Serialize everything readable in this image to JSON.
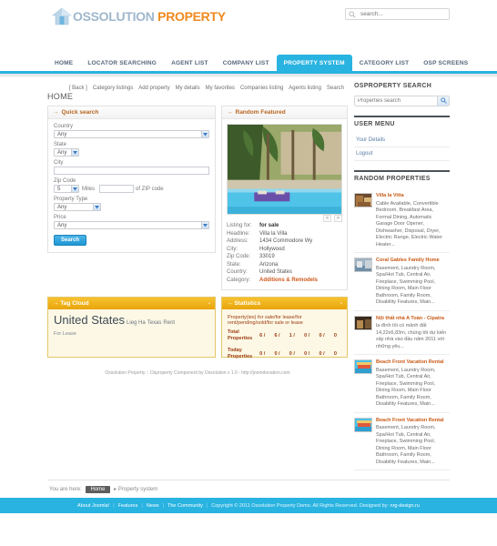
{
  "header": {
    "logo_os": "OSSOLUTION",
    "logo_property": "PROPERTY",
    "search_placeholder": "search...",
    "search_value": ""
  },
  "mainnav": {
    "items": [
      {
        "label": "HOME",
        "active": false
      },
      {
        "label": "LOCATOR SEARCHING",
        "active": false
      },
      {
        "label": "AGENT LIST",
        "active": false
      },
      {
        "label": "COMPANY LIST",
        "active": false
      },
      {
        "label": "PROPERTY SYSTEM",
        "active": true
      },
      {
        "label": "CATEGORY LIST",
        "active": false
      },
      {
        "label": "OSP SCREENS",
        "active": false
      }
    ]
  },
  "subnav": {
    "items": [
      "[ Back ]",
      "Category listings",
      "Add property",
      "My details",
      "My favorites",
      "Companies listing",
      "Agents listing",
      "Search"
    ]
  },
  "page": {
    "title": "HOME"
  },
  "quick_search": {
    "title": "Quick search",
    "country_label": "Country",
    "country_value": "Any",
    "state_label": "State",
    "state_value": "Any",
    "city_label": "City",
    "city_value": "",
    "zip_label": "Zip Code",
    "zip_miles_value": "5",
    "zip_miles_text": "Miles",
    "zip_of_text": "of ZIP code",
    "zip_code_value": "",
    "property_type_label": "Property Type",
    "property_type_value": "Any",
    "price_label": "Price",
    "price_value": "Any",
    "search_button": "Search"
  },
  "random_featured": {
    "title": "Random Featured",
    "nav_prev": "<",
    "nav_next": ">",
    "fields": [
      {
        "key": "Listing for:",
        "value": "for sale",
        "style": "bold"
      },
      {
        "key": "Headline:",
        "value": "Villa la Villa",
        "style": "normal"
      },
      {
        "key": "Address:",
        "value": "1434 Commodore Wy",
        "style": "normal"
      },
      {
        "key": "City:",
        "value": "Hollywood",
        "style": "normal"
      },
      {
        "key": "Zip Code:",
        "value": "33019",
        "style": "normal"
      },
      {
        "key": "State:",
        "value": "Arizona",
        "style": "normal"
      },
      {
        "key": "Country:",
        "value": "United States",
        "style": "normal"
      },
      {
        "key": "Category:",
        "value": "Additions & Remodels",
        "style": "orange"
      }
    ]
  },
  "tag_cloud": {
    "title": "Tag Cloud",
    "collapse": "-",
    "tags_large": "United States",
    "tags_small": [
      "Lieg Ha",
      "Texas",
      "Rent"
    ],
    "tags_tiny": "For Lease"
  },
  "statistics": {
    "title": "Statistics",
    "collapse": "-",
    "header_text": "Property(ies) for sale/for lease/for rent/pending/sold/for sale or lease",
    "rows": [
      {
        "label": "Total Properties",
        "values": [
          "6",
          "6",
          "1",
          "0",
          "0",
          "0"
        ]
      },
      {
        "label": "Today Properties",
        "values": [
          "0",
          "0",
          "0",
          "0",
          "0",
          "0"
        ]
      }
    ],
    "separator": "/"
  },
  "credits": "Ossolution Property :: Osproperty Component by Ossolution v 1.0 - http://joomdonation.com",
  "sidebar": {
    "search_module": {
      "title": "OSPROPERTY SEARCH",
      "placeholder": "Properties search",
      "value": "",
      "button_icon": "search-icon"
    },
    "user_menu": {
      "title": "USER MENU",
      "items": [
        "Your Details",
        "Logout"
      ]
    },
    "random_properties": {
      "title": "RANDOM PROPERTIES",
      "items": [
        {
          "title": "Villa la Vitta",
          "desc": "Cable Available, Convertible Bedroom, Breakfast Area, Formal Dining, Automatic Garage Door Opener, Dishwasher, Disposal, Dryer, Electric Range, Electric Water Heater..."
        },
        {
          "title": "Coral Gables Family Home",
          "desc": "Basement, Laundry Room, Spa/Hot Tub, Central Air, Fireplace, Swimming Pool, Dining Room, Main Floor Bathroom, Family Room, Disability Features, Main..."
        },
        {
          "title": "Nội thất nhà A Toàn - Cipatra",
          "desc": "la đình tôi có mảnh đất 14,22x6,83m, chúng tôi dự kiến xây nhà vào đầu năm 2011 với những yêu..."
        },
        {
          "title": "Beach Front Vacation Rental",
          "desc": "Basement, Laundry Room, Spa/Hot Tub, Central Air, Fireplace, Swimming Pool, Dining Room, Main Floor Bathroom, Family Room, Disability Features, Main..."
        },
        {
          "title": "Beach Front Vacation Rental",
          "desc": "Basement, Laundry Room, Spa/Hot Tub, Central Air, Fireplace, Swimming Pool, Dining Room, Main Floor Bathroom, Family Room, Disability Features, Main..."
        }
      ]
    }
  },
  "breadcrumb": {
    "prefix": "You are here:",
    "home": "Home",
    "arrow": "▸",
    "current": "Property system"
  },
  "footer": {
    "links": [
      "About Joomla!",
      "Features",
      "News",
      "The Community"
    ],
    "copyright": "Copyright © 2011 Ossolution Property Demo. All Rights Reserved. Designed by:",
    "designer": "nrg-design.ru"
  },
  "colors": {
    "accent": "#29b3e0",
    "orange": "#f08a1e",
    "yellow": "#e8a50c"
  }
}
